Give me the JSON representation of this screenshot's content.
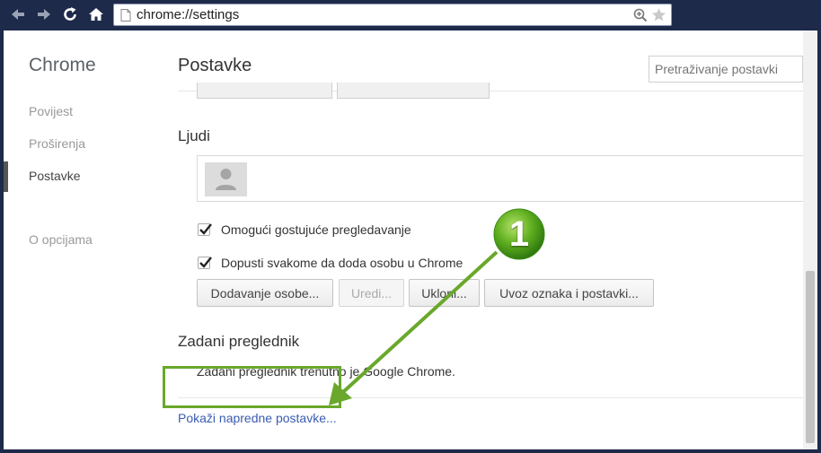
{
  "toolbar": {
    "url": "chrome://settings",
    "icons": [
      "back-icon",
      "forward-icon",
      "reload-icon",
      "home-icon",
      "page-icon",
      "zoom-icon",
      "star-icon"
    ]
  },
  "sidebar": {
    "brand": "Chrome",
    "items": [
      {
        "label": "Povijest",
        "active": false
      },
      {
        "label": "Proširenja",
        "active": false
      },
      {
        "label": "Postavke",
        "active": true
      },
      {
        "label": "O opcijama",
        "active": false
      }
    ]
  },
  "main": {
    "title": "Postavke",
    "search_placeholder": "Pretraživanje postavki",
    "people": {
      "title": "Ljudi",
      "checkboxes": [
        {
          "label": "Omogući gostujuće pregledavanje",
          "checked": true
        },
        {
          "label": "Dopusti svakome da doda osobu u Chrome",
          "checked": true
        }
      ],
      "buttons": [
        {
          "label": "Dodavanje osobe...",
          "disabled": false
        },
        {
          "label": "Uredi...",
          "disabled": true
        },
        {
          "label": "Ukloni...",
          "disabled": false
        },
        {
          "label": "Uvoz oznaka i postavki...",
          "disabled": false
        }
      ]
    },
    "default_browser": {
      "title": "Zadani preglednik",
      "text": "Zadani preglednik trenutno je Google Chrome."
    },
    "advanced_link": "Pokaži napredne postavke..."
  },
  "annotation": {
    "callout_number": "1",
    "color": "#69a82b"
  },
  "colors": {
    "frame": "#1d2a4a",
    "link": "#3a5bb0",
    "highlight": "#69a82b"
  }
}
